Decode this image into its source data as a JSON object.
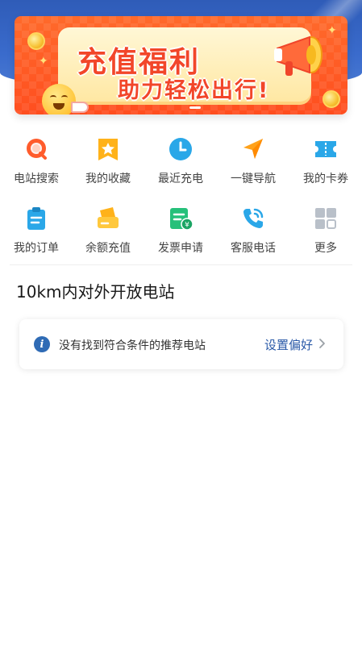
{
  "banner": {
    "line1": "充值福利",
    "line2": "助力轻松出行!"
  },
  "quick_menu": {
    "row1": [
      {
        "label": "电站搜索",
        "icon": "search-icon"
      },
      {
        "label": "我的收藏",
        "icon": "star-icon"
      },
      {
        "label": "最近充电",
        "icon": "clock-icon"
      },
      {
        "label": "一键导航",
        "icon": "navigation-icon"
      },
      {
        "label": "我的卡券",
        "icon": "coupon-icon"
      }
    ],
    "row2": [
      {
        "label": "我的订单",
        "icon": "order-icon"
      },
      {
        "label": "余额充值",
        "icon": "card-recharge-icon"
      },
      {
        "label": "发票申请",
        "icon": "invoice-icon"
      },
      {
        "label": "客服电话",
        "icon": "phone-icon"
      },
      {
        "label": "更多",
        "icon": "more-grid-icon"
      }
    ]
  },
  "nearby": {
    "title": "10km内对外开放电站",
    "empty_message": "没有找到符合条件的推荐电站",
    "action_label": "设置偏好"
  },
  "colors": {
    "header_blue": "#3a6bcc",
    "banner_orange": "#ff5a24",
    "link_blue": "#2b5aa8"
  }
}
